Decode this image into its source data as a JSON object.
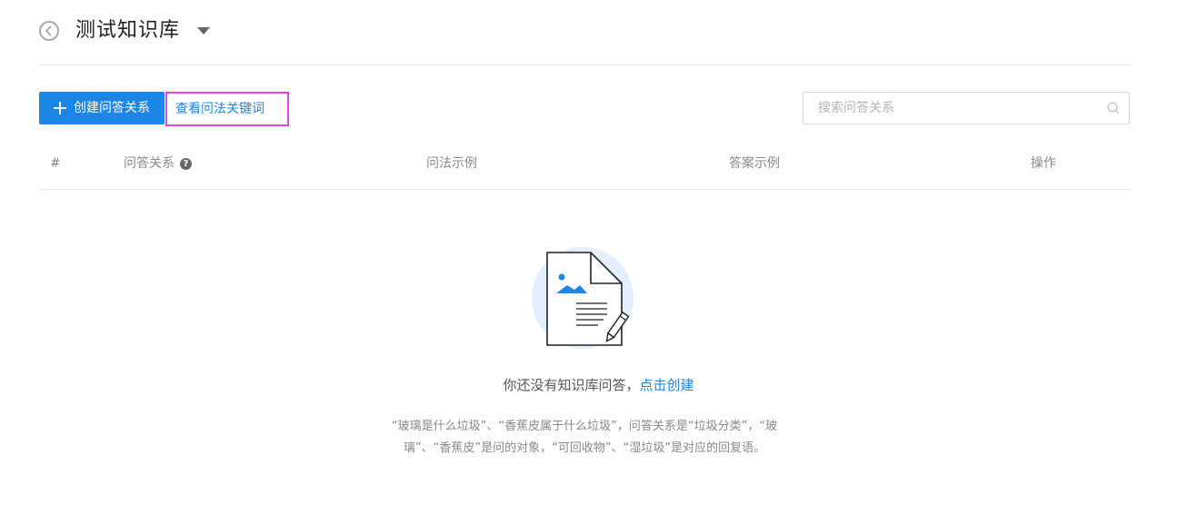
{
  "header": {
    "title": "测试知识库"
  },
  "toolbar": {
    "create_label": "创建问答关系",
    "keywords_link": "查看问法关键词",
    "search_placeholder": "搜索问答关系"
  },
  "table": {
    "columns": [
      "#",
      "问答关系",
      "问法示例",
      "答案示例",
      "操作"
    ],
    "help_glyph": "?"
  },
  "empty": {
    "message": "你还没有知识库问答，",
    "create_link": "点击创建",
    "description": "“玻璃是什么垃圾”、“香蕉皮属于什么垃圾”，问答关系是“垃圾分类”，“玻璃”、“香蕉皮”是问的对象，“可回收物”、“湿垃圾”是对应的回复语。"
  },
  "colors": {
    "primary": "#1c86e6",
    "highlight_border": "#e245e2",
    "illustration_bg": "#e3effc"
  }
}
